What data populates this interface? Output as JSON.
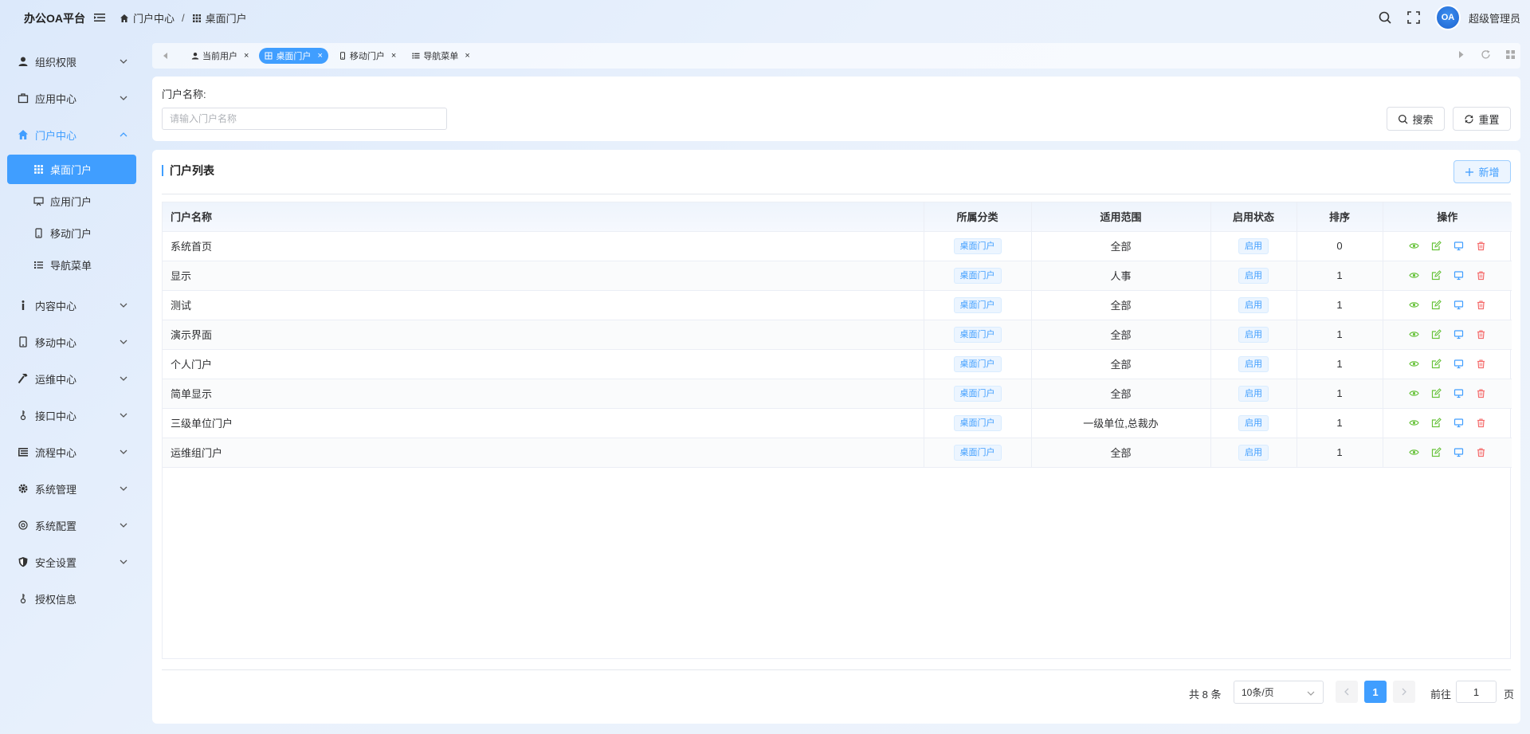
{
  "app": {
    "title": "办公OA平台"
  },
  "breadcrumb": {
    "level1": "门户中心",
    "separator": "/",
    "level2": "桌面门户"
  },
  "user": {
    "avatar_text": "OA",
    "name": "超级管理员"
  },
  "colors": {
    "primary": "#409eff",
    "success": "#67c23a",
    "danger": "#f56c6c"
  },
  "sidebar": {
    "items": [
      {
        "label": "组织权限",
        "icon": "user-icon"
      },
      {
        "label": "应用中心",
        "icon": "briefcase-icon"
      },
      {
        "label": "门户中心",
        "icon": "home-icon",
        "open": true
      },
      {
        "label": "内容中心",
        "icon": "info-icon"
      },
      {
        "label": "移动中心",
        "icon": "mobile-icon"
      },
      {
        "label": "运维中心",
        "icon": "hammer-icon"
      },
      {
        "label": "接口中心",
        "icon": "key-icon"
      },
      {
        "label": "流程中心",
        "icon": "flow-icon"
      },
      {
        "label": "系统管理",
        "icon": "gear-icon"
      },
      {
        "label": "系统配置",
        "icon": "settings-icon"
      },
      {
        "label": "安全设置",
        "icon": "shield-icon"
      },
      {
        "label": "授权信息",
        "icon": "key-icon"
      }
    ],
    "portal_sub": [
      {
        "label": "桌面门户",
        "icon": "grid-icon",
        "active": true
      },
      {
        "label": "应用门户",
        "icon": "presentation-icon"
      },
      {
        "label": "移动门户",
        "icon": "mobile-icon"
      },
      {
        "label": "导航菜单",
        "icon": "list-icon"
      }
    ]
  },
  "tabs": [
    {
      "label": "当前用户",
      "icon": "user-icon"
    },
    {
      "label": "桌面门户",
      "icon": "grid-icon",
      "active": true
    },
    {
      "label": "移动门户",
      "icon": "mobile-icon"
    },
    {
      "label": "导航菜单",
      "icon": "list-icon"
    }
  ],
  "tab_close": "×",
  "search": {
    "label": "门户名称:",
    "placeholder": "请输入门户名称",
    "value": "",
    "search_button": "搜索",
    "reset_button": "重置"
  },
  "list": {
    "title": "门户列表",
    "add_button": "新增",
    "columns": [
      "门户名称",
      "所属分类",
      "适用范围",
      "启用状态",
      "排序",
      "操作"
    ],
    "rows": [
      {
        "name": "系统首页",
        "category": "桌面门户",
        "scope": "全部",
        "status": "启用",
        "order": "0"
      },
      {
        "name": "显示",
        "category": "桌面门户",
        "scope": "人事",
        "status": "启用",
        "order": "1"
      },
      {
        "name": "测试",
        "category": "桌面门户",
        "scope": "全部",
        "status": "启用",
        "order": "1"
      },
      {
        "name": "演示界面",
        "category": "桌面门户",
        "scope": "全部",
        "status": "启用",
        "order": "1"
      },
      {
        "name": "个人门户",
        "category": "桌面门户",
        "scope": "全部",
        "status": "启用",
        "order": "1"
      },
      {
        "name": "简单显示",
        "category": "桌面门户",
        "scope": "全部",
        "status": "启用",
        "order": "1"
      },
      {
        "name": "三级单位门户",
        "category": "桌面门户",
        "scope": "一级单位,总裁办",
        "status": "启用",
        "order": "1"
      },
      {
        "name": "运维组门户",
        "category": "桌面门户",
        "scope": "全部",
        "status": "启用",
        "order": "1"
      }
    ]
  },
  "pagination": {
    "total": "共 8 条",
    "page_size": "10条/页",
    "current": "1",
    "goto_label": "前往",
    "goto_value": "1",
    "page_suffix": "页"
  }
}
